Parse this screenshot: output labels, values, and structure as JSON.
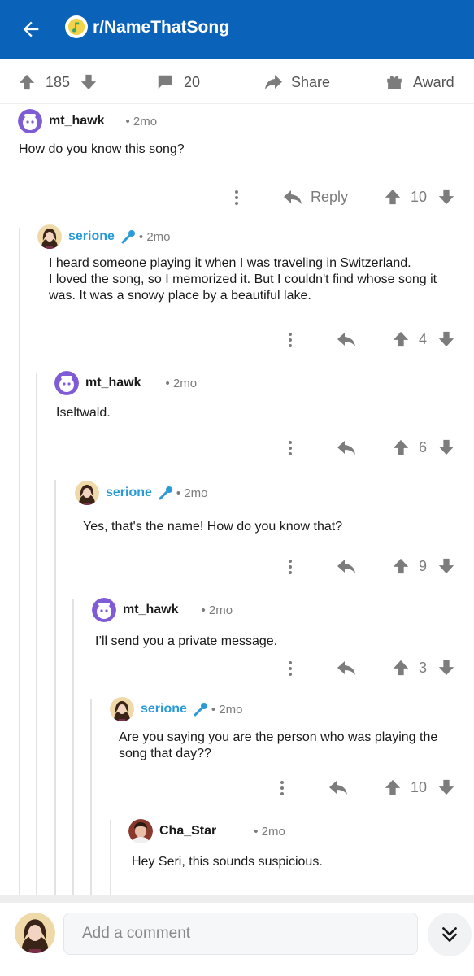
{
  "header": {
    "subreddit": "r/NameThatSong",
    "color": "#0a63b8"
  },
  "post_actions": {
    "votes": "185",
    "comments": "20",
    "share_label": "Share",
    "award_label": "Award"
  },
  "comments": [
    {
      "user": "mt_hawk",
      "age": "2mo",
      "op": false,
      "body": "How do you know this song?",
      "reply_label": "Reply",
      "votes": "10"
    },
    {
      "user": "serione",
      "age": "2mo",
      "op": true,
      "body": "I heard someone playing it when I was traveling in Switzerland.\nI loved the song, so I memorized it. But I couldn't find whose song it\nwas. It was a snowy place by a beautiful lake.",
      "votes": "4"
    },
    {
      "user": "mt_hawk",
      "age": "2mo",
      "op": false,
      "body": "Iseltwald.",
      "votes": "6"
    },
    {
      "user": "serione",
      "age": "2mo",
      "op": true,
      "body": "Yes, that's the name! How do you know that?",
      "votes": "9"
    },
    {
      "user": "mt_hawk",
      "age": "2mo",
      "op": false,
      "body": "I’ll send you a private message.",
      "votes": "3"
    },
    {
      "user": "serione",
      "age": "2mo",
      "op": true,
      "body": "Are you saying you are the person who was playing the\nsong that day??",
      "votes": "10"
    },
    {
      "user": "Cha_Star",
      "age": "2mo",
      "op": false,
      "body": "Hey Seri, this sounds suspicious."
    }
  ],
  "composer": {
    "placeholder": "Add a comment"
  },
  "colors": {
    "op_name": "#2a9bd6",
    "icon_gray": "#7c7c7c"
  }
}
